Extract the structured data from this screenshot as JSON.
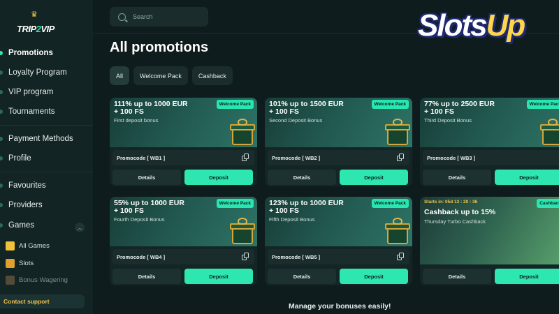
{
  "brand": {
    "logo_text_a": "TRIP",
    "logo_text_b": "2",
    "logo_text_c": "VIP"
  },
  "watermark": {
    "text_a": "Slots",
    "text_b": "Up"
  },
  "sidebar": {
    "items": [
      {
        "label": "Promotions"
      },
      {
        "label": "Loyalty Program"
      },
      {
        "label": "VIP program"
      },
      {
        "label": "Tournaments"
      },
      {
        "label": "Payment Methods"
      },
      {
        "label": "Profile"
      },
      {
        "label": "Favourites"
      },
      {
        "label": "Providers"
      },
      {
        "label": "Games"
      }
    ],
    "sub_items": [
      {
        "label": "All Games",
        "icon": "grid-icon",
        "color": "#f0c23a"
      },
      {
        "label": "Slots",
        "icon": "slot-machine-icon",
        "color": "#e0a030"
      },
      {
        "label": "Bonus Wagering",
        "icon": "bonus-icon",
        "color": "#8a6a4a"
      }
    ],
    "support": "Contact support"
  },
  "search": {
    "placeholder": "Search"
  },
  "page": {
    "title": "All promotions",
    "footer": "Manage your bonuses easily!"
  },
  "filters": [
    "All",
    "Welcome Pack",
    "Cashback"
  ],
  "cards": [
    {
      "title_1": "111% up to 1000 EUR",
      "title_2": "+ 100 FS",
      "subtitle": "First deposit bonus",
      "badge": "Welcome Pack",
      "promocode": "Promocode [ WB1 ]",
      "details": "Details",
      "deposit": "Deposit"
    },
    {
      "title_1": "101% up to 1500 EUR",
      "title_2": "+ 100 FS",
      "subtitle": "Second Deposit Bonus",
      "badge": "Welcome Pack",
      "promocode": "Promocode [ WB2 ]",
      "details": "Details",
      "deposit": "Deposit"
    },
    {
      "title_1": "77% up to 2500 EUR",
      "title_2": "+ 100 FS",
      "subtitle": "Third Deposit Bonus",
      "badge": "Welcome Pack",
      "promocode": "Promocode [ WB3 ]",
      "details": "Details",
      "deposit": "Deposit"
    },
    {
      "title_1": "55% up to 1000 EUR",
      "title_2": "+ 100 FS",
      "subtitle": "Fourth Deposit Bonus",
      "badge": "Welcome Pack",
      "promocode": "Promocode [ WB4 ]",
      "details": "Details",
      "deposit": "Deposit"
    },
    {
      "title_1": "123% up to 1000 EUR",
      "title_2": "+ 100 FS",
      "subtitle": "Fifth Deposit Bonus",
      "badge": "Welcome Pack",
      "promocode": "Promocode [ WB5 ]",
      "details": "Details",
      "deposit": "Deposit"
    },
    {
      "starts": "Starts in: 05d 13 : 20 : 36",
      "title_1": "Cashback up to 15%",
      "subtitle": "Thursday Turbo Cashback",
      "badge": "Cashback",
      "details": "Details",
      "deposit": "Deposit"
    }
  ],
  "colors": {
    "accent": "#2ee6b0",
    "background": "#0f1c1d",
    "support": "#f3c24e"
  }
}
